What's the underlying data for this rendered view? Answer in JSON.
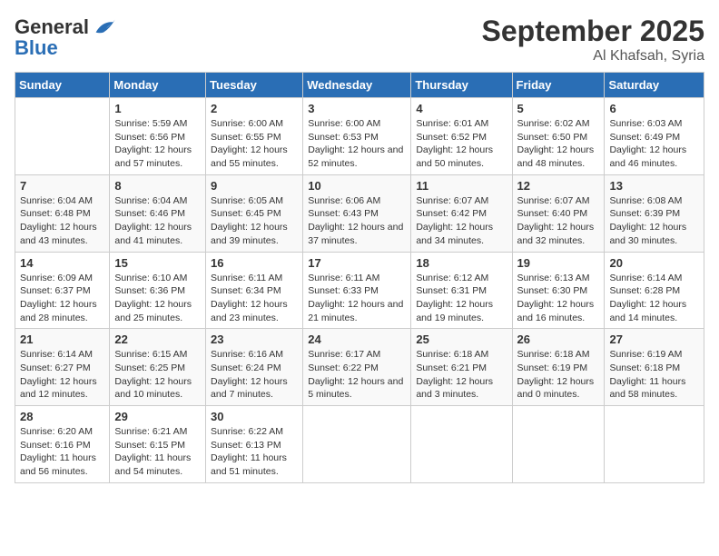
{
  "header": {
    "logo_line1": "General",
    "logo_line2": "Blue",
    "title": "September 2025",
    "subtitle": "Al Khafsah, Syria"
  },
  "days_of_week": [
    "Sunday",
    "Monday",
    "Tuesday",
    "Wednesday",
    "Thursday",
    "Friday",
    "Saturday"
  ],
  "weeks": [
    [
      {
        "num": "",
        "sunrise": "",
        "sunset": "",
        "daylight": ""
      },
      {
        "num": "1",
        "sunrise": "Sunrise: 5:59 AM",
        "sunset": "Sunset: 6:56 PM",
        "daylight": "Daylight: 12 hours and 57 minutes."
      },
      {
        "num": "2",
        "sunrise": "Sunrise: 6:00 AM",
        "sunset": "Sunset: 6:55 PM",
        "daylight": "Daylight: 12 hours and 55 minutes."
      },
      {
        "num": "3",
        "sunrise": "Sunrise: 6:00 AM",
        "sunset": "Sunset: 6:53 PM",
        "daylight": "Daylight: 12 hours and 52 minutes."
      },
      {
        "num": "4",
        "sunrise": "Sunrise: 6:01 AM",
        "sunset": "Sunset: 6:52 PM",
        "daylight": "Daylight: 12 hours and 50 minutes."
      },
      {
        "num": "5",
        "sunrise": "Sunrise: 6:02 AM",
        "sunset": "Sunset: 6:50 PM",
        "daylight": "Daylight: 12 hours and 48 minutes."
      },
      {
        "num": "6",
        "sunrise": "Sunrise: 6:03 AM",
        "sunset": "Sunset: 6:49 PM",
        "daylight": "Daylight: 12 hours and 46 minutes."
      }
    ],
    [
      {
        "num": "7",
        "sunrise": "Sunrise: 6:04 AM",
        "sunset": "Sunset: 6:48 PM",
        "daylight": "Daylight: 12 hours and 43 minutes."
      },
      {
        "num": "8",
        "sunrise": "Sunrise: 6:04 AM",
        "sunset": "Sunset: 6:46 PM",
        "daylight": "Daylight: 12 hours and 41 minutes."
      },
      {
        "num": "9",
        "sunrise": "Sunrise: 6:05 AM",
        "sunset": "Sunset: 6:45 PM",
        "daylight": "Daylight: 12 hours and 39 minutes."
      },
      {
        "num": "10",
        "sunrise": "Sunrise: 6:06 AM",
        "sunset": "Sunset: 6:43 PM",
        "daylight": "Daylight: 12 hours and 37 minutes."
      },
      {
        "num": "11",
        "sunrise": "Sunrise: 6:07 AM",
        "sunset": "Sunset: 6:42 PM",
        "daylight": "Daylight: 12 hours and 34 minutes."
      },
      {
        "num": "12",
        "sunrise": "Sunrise: 6:07 AM",
        "sunset": "Sunset: 6:40 PM",
        "daylight": "Daylight: 12 hours and 32 minutes."
      },
      {
        "num": "13",
        "sunrise": "Sunrise: 6:08 AM",
        "sunset": "Sunset: 6:39 PM",
        "daylight": "Daylight: 12 hours and 30 minutes."
      }
    ],
    [
      {
        "num": "14",
        "sunrise": "Sunrise: 6:09 AM",
        "sunset": "Sunset: 6:37 PM",
        "daylight": "Daylight: 12 hours and 28 minutes."
      },
      {
        "num": "15",
        "sunrise": "Sunrise: 6:10 AM",
        "sunset": "Sunset: 6:36 PM",
        "daylight": "Daylight: 12 hours and 25 minutes."
      },
      {
        "num": "16",
        "sunrise": "Sunrise: 6:11 AM",
        "sunset": "Sunset: 6:34 PM",
        "daylight": "Daylight: 12 hours and 23 minutes."
      },
      {
        "num": "17",
        "sunrise": "Sunrise: 6:11 AM",
        "sunset": "Sunset: 6:33 PM",
        "daylight": "Daylight: 12 hours and 21 minutes."
      },
      {
        "num": "18",
        "sunrise": "Sunrise: 6:12 AM",
        "sunset": "Sunset: 6:31 PM",
        "daylight": "Daylight: 12 hours and 19 minutes."
      },
      {
        "num": "19",
        "sunrise": "Sunrise: 6:13 AM",
        "sunset": "Sunset: 6:30 PM",
        "daylight": "Daylight: 12 hours and 16 minutes."
      },
      {
        "num": "20",
        "sunrise": "Sunrise: 6:14 AM",
        "sunset": "Sunset: 6:28 PM",
        "daylight": "Daylight: 12 hours and 14 minutes."
      }
    ],
    [
      {
        "num": "21",
        "sunrise": "Sunrise: 6:14 AM",
        "sunset": "Sunset: 6:27 PM",
        "daylight": "Daylight: 12 hours and 12 minutes."
      },
      {
        "num": "22",
        "sunrise": "Sunrise: 6:15 AM",
        "sunset": "Sunset: 6:25 PM",
        "daylight": "Daylight: 12 hours and 10 minutes."
      },
      {
        "num": "23",
        "sunrise": "Sunrise: 6:16 AM",
        "sunset": "Sunset: 6:24 PM",
        "daylight": "Daylight: 12 hours and 7 minutes."
      },
      {
        "num": "24",
        "sunrise": "Sunrise: 6:17 AM",
        "sunset": "Sunset: 6:22 PM",
        "daylight": "Daylight: 12 hours and 5 minutes."
      },
      {
        "num": "25",
        "sunrise": "Sunrise: 6:18 AM",
        "sunset": "Sunset: 6:21 PM",
        "daylight": "Daylight: 12 hours and 3 minutes."
      },
      {
        "num": "26",
        "sunrise": "Sunrise: 6:18 AM",
        "sunset": "Sunset: 6:19 PM",
        "daylight": "Daylight: 12 hours and 0 minutes."
      },
      {
        "num": "27",
        "sunrise": "Sunrise: 6:19 AM",
        "sunset": "Sunset: 6:18 PM",
        "daylight": "Daylight: 11 hours and 58 minutes."
      }
    ],
    [
      {
        "num": "28",
        "sunrise": "Sunrise: 6:20 AM",
        "sunset": "Sunset: 6:16 PM",
        "daylight": "Daylight: 11 hours and 56 minutes."
      },
      {
        "num": "29",
        "sunrise": "Sunrise: 6:21 AM",
        "sunset": "Sunset: 6:15 PM",
        "daylight": "Daylight: 11 hours and 54 minutes."
      },
      {
        "num": "30",
        "sunrise": "Sunrise: 6:22 AM",
        "sunset": "Sunset: 6:13 PM",
        "daylight": "Daylight: 11 hours and 51 minutes."
      },
      {
        "num": "",
        "sunrise": "",
        "sunset": "",
        "daylight": ""
      },
      {
        "num": "",
        "sunrise": "",
        "sunset": "",
        "daylight": ""
      },
      {
        "num": "",
        "sunrise": "",
        "sunset": "",
        "daylight": ""
      },
      {
        "num": "",
        "sunrise": "",
        "sunset": "",
        "daylight": ""
      }
    ]
  ]
}
